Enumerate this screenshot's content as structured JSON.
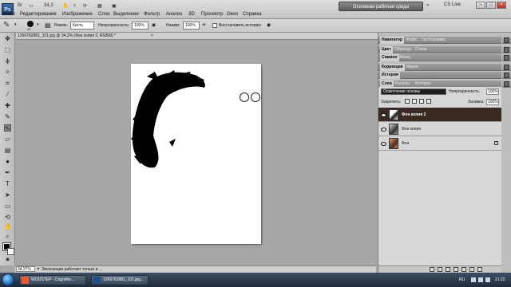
{
  "app": {
    "logo": "Ps",
    "zoom_value": "34,3",
    "workspace": "Основная рабочая среда",
    "cslive": "CS Live"
  },
  "menu": [
    "Файл",
    "Редактирование",
    "Изображение",
    "Слои",
    "Выделение",
    "Фильтр",
    "Анализ",
    "3D",
    "Просмотр",
    "Окно",
    "Справка"
  ],
  "options": {
    "brush_size": "20",
    "mode_label": "Режим:",
    "mode_value": "Кисть",
    "opacity_label": "Непрозрачность:",
    "opacity_value": "100%",
    "pressure_label": "Нажим:",
    "pressure_value": "100%",
    "restore_history": "Восстановить историю"
  },
  "document": {
    "title": "1266762881_101.jpg @ 34,3% (Фон копия 2, RGB/8) *"
  },
  "status": {
    "zoom": "34,27%",
    "message": "Экспозиция работает только в ..."
  },
  "panels": {
    "group1": [
      "Навигатор",
      "Инфо",
      "Гистограмма"
    ],
    "group2": [
      "Цвет",
      "Образцы",
      "Стили"
    ],
    "group3": [
      "Символ",
      "Абзац"
    ],
    "group4": [
      "Коррекция",
      "Маски"
    ],
    "group5": [
      "История"
    ],
    "group6": [
      "Слои",
      "Каналы",
      "Контуры"
    ]
  },
  "layers": {
    "blend_mode": "Осветление основы",
    "opacity_label": "Непрозрачность:",
    "opacity_value": "100%",
    "lock_label": "Закрепить:",
    "fill_label": "Заливка:",
    "fill_value": "100%",
    "items": [
      {
        "name": "Фон копия 2"
      },
      {
        "name": "Фон копия"
      },
      {
        "name": "Фон"
      }
    ]
  },
  "taskbar": {
    "items": [
      "WOOSTEP - Cogoshe...",
      "1266762881_101.jpg..."
    ],
    "lang": "RU",
    "clock": "21:22"
  }
}
